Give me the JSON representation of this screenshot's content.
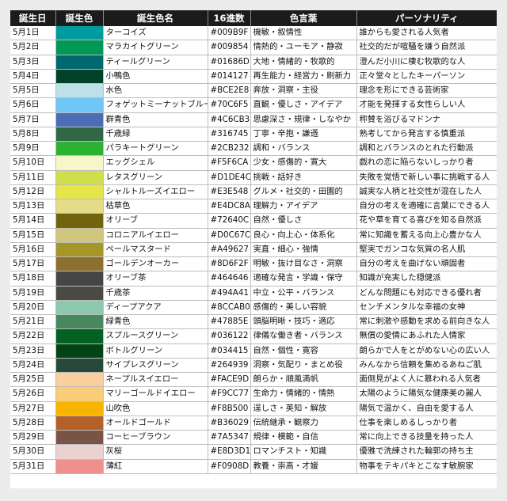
{
  "headers": [
    "誕生日",
    "誕生色",
    "誕生色名",
    "16進数",
    "色言葉",
    "パーソナリティ"
  ],
  "rows": [
    {
      "date": "5月1日",
      "color": "#009B9F",
      "name": "ターコイズ",
      "hex": "#009B9F",
      "words": "機敏・叙情性",
      "personality": "誰からも愛される人気者"
    },
    {
      "date": "5月2日",
      "color": "#009854",
      "name": "マラカイトグリーン",
      "hex": "#009854",
      "words": "情熱的・ユーモア・静寂",
      "personality": "社交的だが喧騒を嫌う自然派"
    },
    {
      "date": "5月3日",
      "color": "#01686D",
      "name": "ティールグリーン",
      "hex": "#01686D",
      "words": "大地・情緒的・牧歌的",
      "personality": "澄んだ小川に棲む牧歌的な人"
    },
    {
      "date": "5月4日",
      "color": "#014127",
      "name": "小鴨色",
      "hex": "#014127",
      "words": "再生能力・経営力・刷新力",
      "personality": "正々堂々としたキーパーソン"
    },
    {
      "date": "5月5日",
      "color": "#BCE2E8",
      "name": "水色",
      "hex": "#BCE2E8",
      "words": "奔放・洞察・主役",
      "personality": "理念を形にできる芸術家"
    },
    {
      "date": "5月6日",
      "color": "#70C6F5",
      "name": "フォゲットミーナットブルー",
      "hex": "#70C6F5",
      "words": "直観・優しさ・アイデア",
      "personality": "才能を発揮する女性らしい人"
    },
    {
      "date": "5月7日",
      "color": "#4C6CB3",
      "name": "群青色",
      "hex": "#4C6CB3",
      "words": "思慮深さ・規律・しなやか",
      "personality": "称賛を浴びるマドンナ"
    },
    {
      "date": "5月8日",
      "color": "#316745",
      "name": "千歳緑",
      "hex": "#316745",
      "words": "丁寧・辛抱・謙遜",
      "personality": "熟考してから発言する慎重派"
    },
    {
      "date": "5月9日",
      "color": "#2CB232",
      "name": "パラキートグリーン",
      "hex": "#2CB232",
      "words": "調和・バランス",
      "personality": "調和とバランスのとれた行動派"
    },
    {
      "date": "5月10日",
      "color": "#F5F6CA",
      "name": "エッグシェル",
      "hex": "#F5F6CA",
      "words": "少女・感傷的・寛大",
      "personality": "戯れの恋に陥らないしっかり者"
    },
    {
      "date": "5月11日",
      "color": "#D1DE4C",
      "name": "レタスグリーン",
      "hex": "#D1DE4C",
      "words": "挑戦・話好き",
      "personality": "失敗を覚悟で新しい事に挑戦する人"
    },
    {
      "date": "5月12日",
      "color": "#E3E548",
      "name": "シャルトルーズイエロー",
      "hex": "#E3E548",
      "words": "グルメ・社交的・田園的",
      "personality": "誠実な人柄と社交性が混在した人"
    },
    {
      "date": "5月13日",
      "color": "#E4DC8A",
      "name": "枯草色",
      "hex": "#E4DC8A",
      "words": "理解力・アイデア",
      "personality": "自分の考えを適確に言葉にできる人"
    },
    {
      "date": "5月14日",
      "color": "#72640C",
      "name": "オリーブ",
      "hex": "#72640C",
      "words": "自然・優しさ",
      "personality": "花や草を育てる喜びを知る自然派"
    },
    {
      "date": "5月15日",
      "color": "#D0C67C",
      "name": "コロニアルイエロー",
      "hex": "#D0C67C",
      "words": "良心・向上心・体系化",
      "personality": "常に知識を蓄える向上心豊かな人"
    },
    {
      "date": "5月16日",
      "color": "#A49627",
      "name": "ペールマスタード",
      "hex": "#A49627",
      "words": "実直・細心・強情",
      "personality": "堅実でガンコな気質の名人肌"
    },
    {
      "date": "5月17日",
      "color": "#8D6F2F",
      "name": "ゴールデンオーカー",
      "hex": "#8D6F2F",
      "words": "明敏・抜け目なさ・洞察",
      "personality": "自分の考えを曲げない頑固者"
    },
    {
      "date": "5月18日",
      "color": "#464646",
      "name": "オリーブ茶",
      "hex": "#464646",
      "words": "適確な発言・学識・保守",
      "personality": "知識が充実した穏健派"
    },
    {
      "date": "5月19日",
      "color": "#494A41",
      "name": "千歳茶",
      "hex": "#494A41",
      "words": "中立・公平・バランス",
      "personality": "どんな問題にも対応できる優れ者"
    },
    {
      "date": "5月20日",
      "color": "#8CCAB0",
      "name": "ディープアクア",
      "hex": "#8CCAB0",
      "words": "感傷的・美しい容貌",
      "personality": "センチメンタルな幸福の女神"
    },
    {
      "date": "5月21日",
      "color": "#47885E",
      "name": "緑青色",
      "hex": "#47885E",
      "words": "頭脳明晰・技巧・適応",
      "personality": "常に刺激や感動を求める前向きな人"
    },
    {
      "date": "5月22日",
      "color": "#036122",
      "name": "スプルースグリーン",
      "hex": "#036122",
      "words": "律儀な働き者・バランス",
      "personality": "無償の愛情にあふれた人情家"
    },
    {
      "date": "5月23日",
      "color": "#034415",
      "name": "ボトルグリーン",
      "hex": "#034415",
      "words": "自然・個性・寛容",
      "personality": "朗らかで人をとがめない心の広い人"
    },
    {
      "date": "5月24日",
      "color": "#264939",
      "name": "サイプレスグリーン",
      "hex": "#264939",
      "words": "洞察・気配り・まとめ役",
      "personality": "みんなから信頼を集めるあねご肌"
    },
    {
      "date": "5月25日",
      "color": "#FACE9D",
      "name": "ネープルスイエロー",
      "hex": "#FACE9D",
      "words": "朗らか・順風満帆",
      "personality": "面倒見がよく人に慕われる人気者"
    },
    {
      "date": "5月26日",
      "color": "#F9CC77",
      "name": "マリーゴールドイエロー",
      "hex": "#F9CC77",
      "words": "生命力・情緒的・情熱",
      "personality": "太陽のように陽気な健康美の麗人"
    },
    {
      "date": "5月27日",
      "color": "#F8B500",
      "name": "山吹色",
      "hex": "#F8B500",
      "words": "逞しさ・英知・解放",
      "personality": "陽気で温かく、自由を愛する人"
    },
    {
      "date": "5月28日",
      "color": "#B36029",
      "name": "オールドゴールド",
      "hex": "#B36029",
      "words": "伝統継承・観察力",
      "personality": "仕事を楽しめるしっかり者"
    },
    {
      "date": "5月29日",
      "color": "#7A5347",
      "name": "コーヒーブラウン",
      "hex": "#7A5347",
      "words": "規律・模範・自信",
      "personality": "常に向上できる技量を持った人"
    },
    {
      "date": "5月30日",
      "color": "#E8D3D1",
      "name": "灰桜",
      "hex": "#E8D3D1",
      "words": "ロマンチスト・知識",
      "personality": "優雅で洗練された輪郭の持ち主"
    },
    {
      "date": "5月31日",
      "color": "#F0908D",
      "name": "薄紅",
      "hex": "#F0908D",
      "words": "教養・崇高・才媛",
      "personality": "物事をテキパキとこなす敏腕家"
    }
  ]
}
